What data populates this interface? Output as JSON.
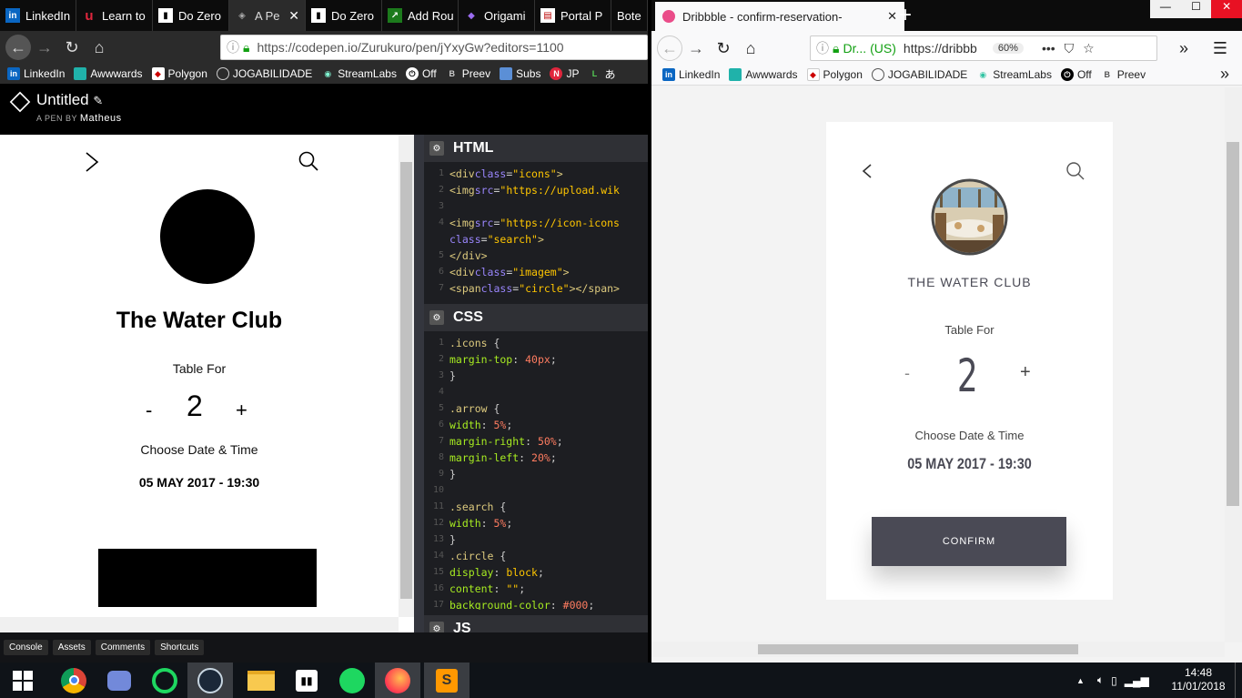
{
  "left_browser": {
    "tabs": [
      "LinkedIn",
      "Learn to",
      "Do Zero",
      "A Pe",
      "Do Zero",
      "Add Rou",
      "Origami",
      "Portal P",
      "Bote"
    ],
    "url": "https://codepen.io/Zurukuro/pen/jYxyGw?editors=1100",
    "bookmarks": [
      "LinkedIn",
      "Awwwards",
      "Polygon",
      "JOGABILIDADE",
      "StreamLabs",
      "Off",
      "Preev",
      "Subs",
      "JP",
      "あ"
    ]
  },
  "codepen": {
    "title": "Untitled",
    "byline": "A PEN BY",
    "author": "Matheus",
    "preview": {
      "restaurant": "The Water Club",
      "table_for": "Table For",
      "minus": "-",
      "count": "2",
      "plus": "+",
      "choose": "Choose Date & Time",
      "datetime": "05 MAY 2017 - 19:30"
    },
    "html_label": "HTML",
    "css_label": "CSS",
    "js_label": "JS",
    "footer": [
      "Console",
      "Assets",
      "Comments",
      "Shortcuts"
    ]
  },
  "right_browser": {
    "tab_title": "Dribbble - confirm-reservation-",
    "site_identity": "Dr...",
    "identity_region": "(US)",
    "url": "https://dribbb",
    "zoom": "60%",
    "bookmarks": [
      "LinkedIn",
      "Awwwards",
      "Polygon",
      "JOGABILIDADE",
      "StreamLabs",
      "Off",
      "Preev"
    ]
  },
  "dribbble_card": {
    "restaurant": "THE WATER CLUB",
    "table_for": "Table For",
    "minus": "-",
    "count": "2",
    "plus": "+",
    "choose": "Choose Date & Time",
    "datetime": "05 MAY 2017 - 19:30",
    "confirm": "CONFIRM"
  },
  "taskbar": {
    "time": "14:48",
    "date": "11/01/2018"
  }
}
